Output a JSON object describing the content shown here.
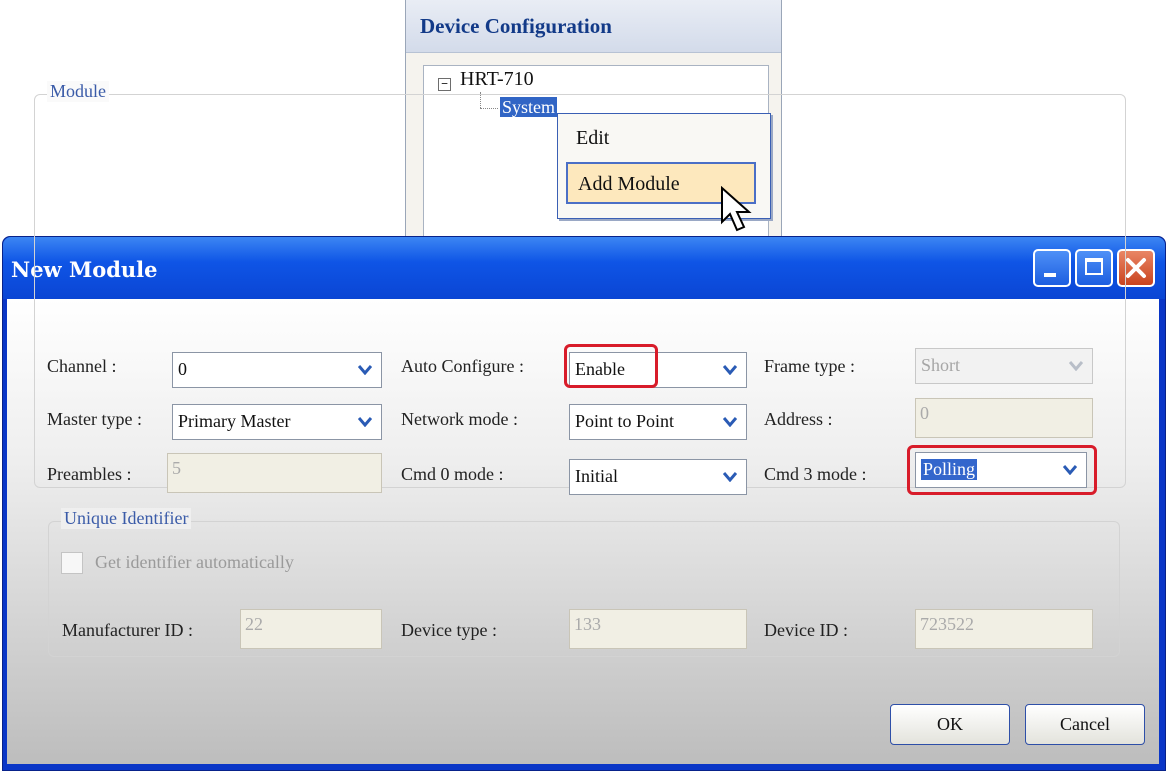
{
  "device_config": {
    "title": "Device Configuration",
    "tree": {
      "root": "HRT-710",
      "child": "System"
    },
    "context_menu": {
      "items": [
        "Edit",
        "Add Module"
      ]
    }
  },
  "dialog": {
    "title": "New Module",
    "module_group": {
      "title": "Module",
      "channel": {
        "label": "Channel :",
        "value": "0"
      },
      "auto_configure": {
        "label": "Auto Configure :",
        "value": "Enable"
      },
      "frame_type": {
        "label": "Frame type :",
        "value": "Short"
      },
      "master_type": {
        "label": "Master type :",
        "value": "Primary Master"
      },
      "network_mode": {
        "label": "Network mode :",
        "value": "Point to Point"
      },
      "address": {
        "label": "Address :",
        "value": "0"
      },
      "preambles": {
        "label": "Preambles :",
        "value": "5"
      },
      "cmd0_mode": {
        "label": "Cmd 0 mode :",
        "value": "Initial"
      },
      "cmd3_mode": {
        "label": "Cmd 3 mode :",
        "value": "Polling"
      }
    },
    "unique_identifier_group": {
      "title": "Unique Identifier",
      "auto_checkbox_label": "Get identifier automatically",
      "manufacturer_id": {
        "label": "Manufacturer ID :",
        "value": "22"
      },
      "device_type": {
        "label": "Device type :",
        "value": "133"
      },
      "device_id": {
        "label": "Device ID :",
        "value": "723522"
      }
    },
    "buttons": {
      "ok": "OK",
      "cancel": "Cancel"
    }
  },
  "colors": {
    "titlebar": "#0f55e6",
    "highlight": "#d81c2a",
    "selection": "#3366cc"
  }
}
